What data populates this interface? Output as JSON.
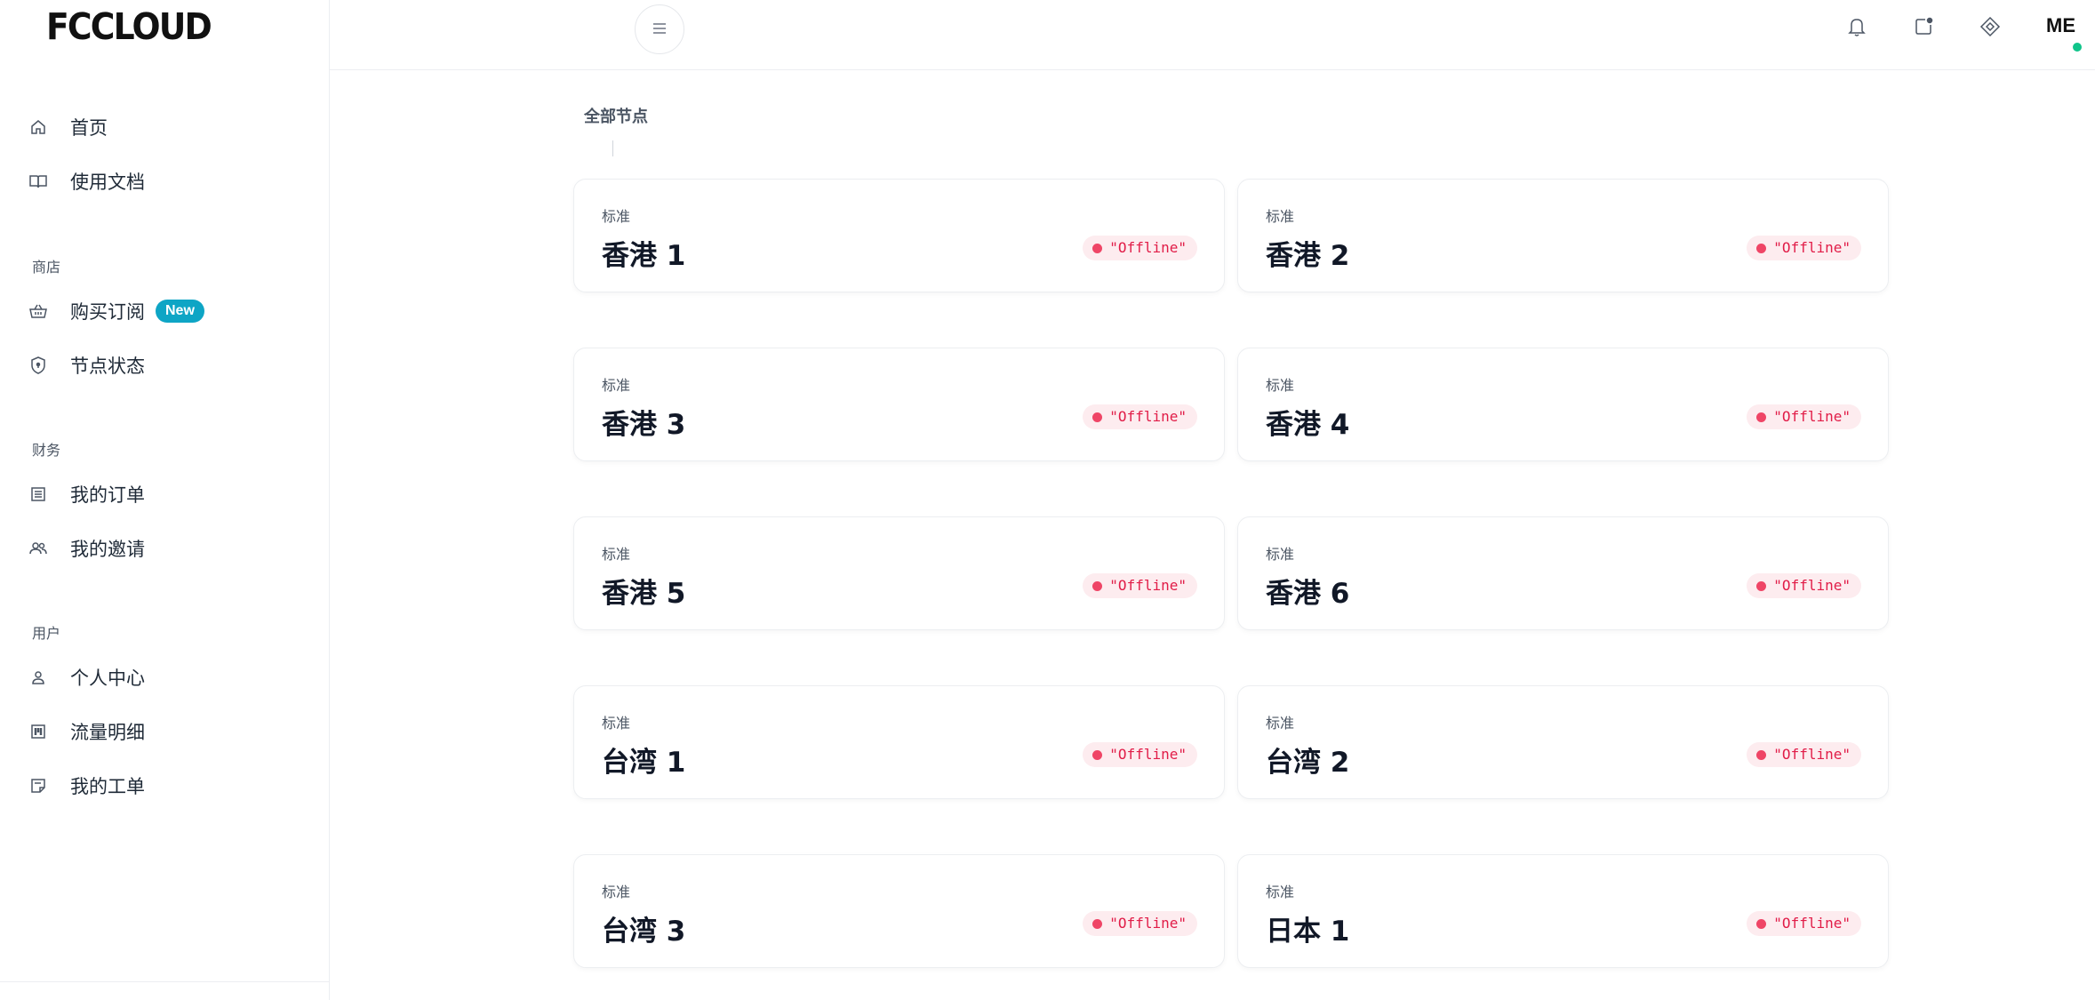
{
  "brand": {
    "logo_text": "FCCLOUD"
  },
  "sidebar": {
    "top_items": [
      {
        "label": "首页",
        "icon": "home-icon"
      },
      {
        "label": "使用文档",
        "icon": "book-icon"
      }
    ],
    "sections": [
      {
        "title": "商店",
        "items": [
          {
            "label": "购买订阅",
            "icon": "basket-icon",
            "badge": "New"
          },
          {
            "label": "节点状态",
            "icon": "shield-icon"
          }
        ]
      },
      {
        "title": "财务",
        "items": [
          {
            "label": "我的订单",
            "icon": "receipt-icon"
          },
          {
            "label": "我的邀请",
            "icon": "users-icon"
          }
        ]
      },
      {
        "title": "用户",
        "items": [
          {
            "label": "个人中心",
            "icon": "user-icon"
          },
          {
            "label": "流量明细",
            "icon": "traffic-icon"
          },
          {
            "label": "我的工单",
            "icon": "ticket-icon"
          }
        ]
      }
    ]
  },
  "topbar": {
    "icons": [
      "menu-icon",
      "bell-icon",
      "notification-app-icon",
      "diamond-icon"
    ],
    "avatar_text": "ME",
    "online_color": "#10c48a"
  },
  "main": {
    "title": "全部节点",
    "nodes": [
      {
        "tier": "标准",
        "name": "香港 1",
        "status": "\"Offline\""
      },
      {
        "tier": "标准",
        "name": "香港 2",
        "status": "\"Offline\""
      },
      {
        "tier": "标准",
        "name": "香港 3",
        "status": "\"Offline\""
      },
      {
        "tier": "标准",
        "name": "香港 4",
        "status": "\"Offline\""
      },
      {
        "tier": "标准",
        "name": "香港 5",
        "status": "\"Offline\""
      },
      {
        "tier": "标准",
        "name": "香港 6",
        "status": "\"Offline\""
      },
      {
        "tier": "标准",
        "name": "台湾 1",
        "status": "\"Offline\""
      },
      {
        "tier": "标准",
        "name": "台湾 2",
        "status": "\"Offline\""
      },
      {
        "tier": "标准",
        "name": "台湾 3",
        "status": "\"Offline\""
      },
      {
        "tier": "标准",
        "name": "日本 1",
        "status": "\"Offline\""
      }
    ]
  },
  "colors": {
    "accent": "#0ea5c5",
    "offline": "#e11d48",
    "offline_bg": "#fdecef"
  }
}
